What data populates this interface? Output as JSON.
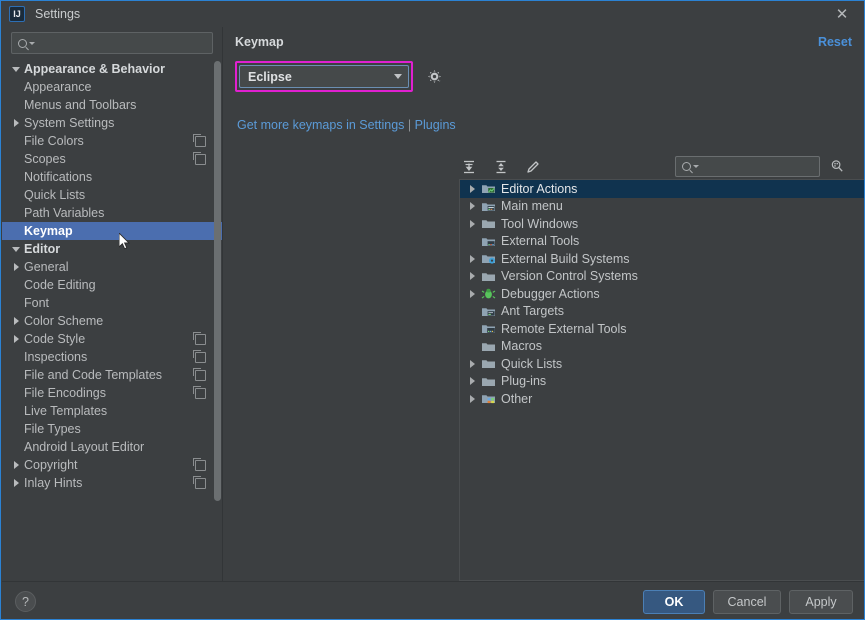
{
  "window": {
    "title": "Settings",
    "app_icon": "intellij-idea-icon",
    "close_icon": "close-icon"
  },
  "sidebar": {
    "search": {
      "value": "",
      "placeholder": "",
      "icon": "search-icon"
    },
    "items": [
      {
        "label": "Appearance & Behavior",
        "level": 0,
        "arrow": "down",
        "group": true,
        "badge": false,
        "selected": false
      },
      {
        "label": "Appearance",
        "level": 1,
        "arrow": "none",
        "group": false,
        "badge": false,
        "selected": false
      },
      {
        "label": "Menus and Toolbars",
        "level": 1,
        "arrow": "none",
        "group": false,
        "badge": false,
        "selected": false
      },
      {
        "label": "System Settings",
        "level": 1,
        "arrow": "right",
        "group": false,
        "badge": false,
        "selected": false
      },
      {
        "label": "File Colors",
        "level": 1,
        "arrow": "none",
        "group": false,
        "badge": true,
        "selected": false
      },
      {
        "label": "Scopes",
        "level": 1,
        "arrow": "none",
        "group": false,
        "badge": true,
        "selected": false
      },
      {
        "label": "Notifications",
        "level": 1,
        "arrow": "none",
        "group": false,
        "badge": false,
        "selected": false
      },
      {
        "label": "Quick Lists",
        "level": 1,
        "arrow": "none",
        "group": false,
        "badge": false,
        "selected": false
      },
      {
        "label": "Path Variables",
        "level": 1,
        "arrow": "none",
        "group": false,
        "badge": false,
        "selected": false
      },
      {
        "label": "Keymap",
        "level": 0,
        "arrow": "none",
        "group": true,
        "badge": false,
        "selected": true
      },
      {
        "label": "Editor",
        "level": 0,
        "arrow": "down",
        "group": true,
        "badge": false,
        "selected": false
      },
      {
        "label": "General",
        "level": 1,
        "arrow": "right",
        "group": false,
        "badge": false,
        "selected": false
      },
      {
        "label": "Code Editing",
        "level": 1,
        "arrow": "none",
        "group": false,
        "badge": false,
        "selected": false
      },
      {
        "label": "Font",
        "level": 1,
        "arrow": "none",
        "group": false,
        "badge": false,
        "selected": false
      },
      {
        "label": "Color Scheme",
        "level": 1,
        "arrow": "right",
        "group": false,
        "badge": false,
        "selected": false
      },
      {
        "label": "Code Style",
        "level": 1,
        "arrow": "right",
        "group": false,
        "badge": true,
        "selected": false
      },
      {
        "label": "Inspections",
        "level": 1,
        "arrow": "none",
        "group": false,
        "badge": true,
        "selected": false
      },
      {
        "label": "File and Code Templates",
        "level": 1,
        "arrow": "none",
        "group": false,
        "badge": true,
        "selected": false
      },
      {
        "label": "File Encodings",
        "level": 1,
        "arrow": "none",
        "group": false,
        "badge": true,
        "selected": false
      },
      {
        "label": "Live Templates",
        "level": 1,
        "arrow": "none",
        "group": false,
        "badge": false,
        "selected": false
      },
      {
        "label": "File Types",
        "level": 1,
        "arrow": "none",
        "group": false,
        "badge": false,
        "selected": false
      },
      {
        "label": "Android Layout Editor",
        "level": 1,
        "arrow": "none",
        "group": false,
        "badge": false,
        "selected": false
      },
      {
        "label": "Copyright",
        "level": 1,
        "arrow": "right",
        "group": false,
        "badge": true,
        "selected": false
      },
      {
        "label": "Inlay Hints",
        "level": 1,
        "arrow": "right",
        "group": false,
        "badge": true,
        "selected": false
      }
    ]
  },
  "panel": {
    "title": "Keymap",
    "reset_label": "Reset",
    "keymap_combo": {
      "value": "Eclipse",
      "highlight_color": "#e020d0",
      "caret_icon": "chevron-down-icon"
    },
    "gear_icon": "gear-icon",
    "links": {
      "text": "Get more keymaps in Settings",
      "separator": "|",
      "plugins": "Plugins"
    },
    "toolbar": {
      "expand_all": "expand-all-icon",
      "collapse_all": "collapse-all-icon",
      "edit": "edit-pencil-icon"
    },
    "search": {
      "value": "",
      "placeholder": "",
      "icon": "search-icon"
    },
    "filter_icon": "filter-icon",
    "tree": [
      {
        "label": "Editor Actions",
        "arrow": true,
        "icon": "editor-actions-icon",
        "selected": true
      },
      {
        "label": "Main menu",
        "arrow": true,
        "icon": "main-menu-icon",
        "selected": false
      },
      {
        "label": "Tool Windows",
        "arrow": true,
        "icon": "folder-icon",
        "selected": false
      },
      {
        "label": "External Tools",
        "arrow": false,
        "icon": "external-tools-icon",
        "selected": false
      },
      {
        "label": "External Build Systems",
        "arrow": true,
        "icon": "build-systems-icon",
        "selected": false
      },
      {
        "label": "Version Control Systems",
        "arrow": true,
        "icon": "folder-icon",
        "selected": false
      },
      {
        "label": "Debugger Actions",
        "arrow": true,
        "icon": "debugger-bug-icon",
        "selected": false
      },
      {
        "label": "Ant Targets",
        "arrow": false,
        "icon": "ant-targets-icon",
        "selected": false
      },
      {
        "label": "Remote External Tools",
        "arrow": false,
        "icon": "remote-tools-icon",
        "selected": false
      },
      {
        "label": "Macros",
        "arrow": false,
        "icon": "folder-icon",
        "selected": false
      },
      {
        "label": "Quick Lists",
        "arrow": true,
        "icon": "folder-icon",
        "selected": false
      },
      {
        "label": "Plug-ins",
        "arrow": true,
        "icon": "folder-icon",
        "selected": false
      },
      {
        "label": "Other",
        "arrow": true,
        "icon": "other-icon",
        "selected": false
      }
    ]
  },
  "footer": {
    "help_label": "?",
    "ok_label": "OK",
    "cancel_label": "Cancel",
    "apply_label": "Apply"
  }
}
